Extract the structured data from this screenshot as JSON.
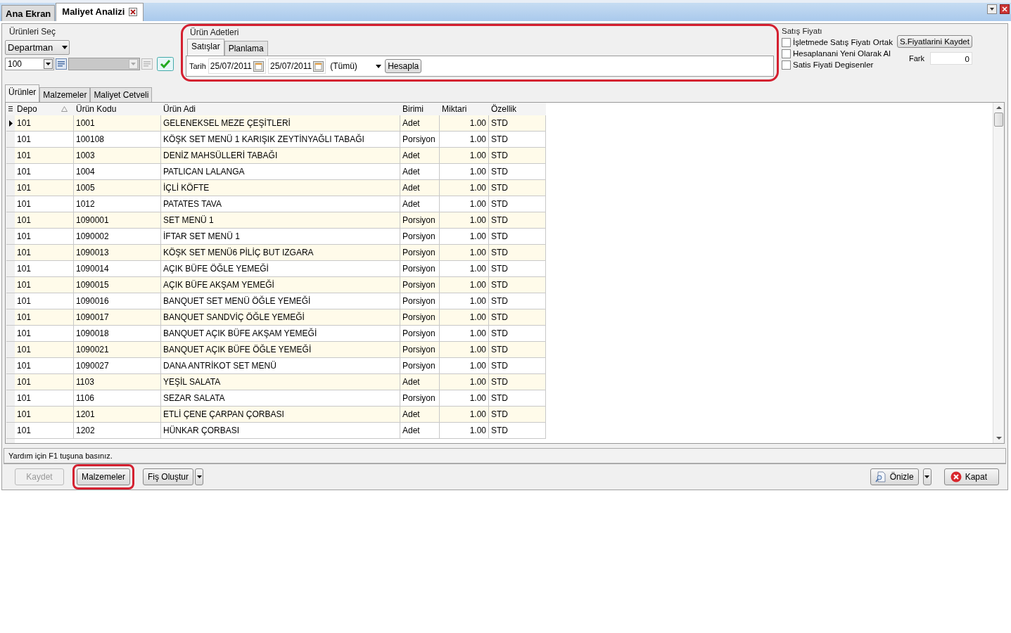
{
  "doc_tabs": [
    {
      "label": "Ana Ekran",
      "selected": false
    },
    {
      "label": "Maliyet Analizi",
      "selected": true,
      "closable": true
    }
  ],
  "select_group": {
    "legend": "Ürünleri Seç",
    "type_dropdown": "Departman",
    "code_value": "100"
  },
  "counts_group": {
    "legend": "Ürün Adetleri",
    "highlighted": true,
    "tabs": [
      {
        "label": "Satışlar",
        "selected": true
      },
      {
        "label": "Planlama",
        "selected": false
      }
    ],
    "date_label": "Tarih",
    "date_from": "25/07/2011",
    "date_to": "25/07/2011",
    "filter": "(Tümü)",
    "button": "Hesapla"
  },
  "price_group": {
    "legend": "Satış Fiyatı",
    "options": [
      {
        "label": "İşletmede Satış Fiyatı Ortak",
        "checked": false
      },
      {
        "label": "Hesaplanani Yeni Olarak Al",
        "checked": false
      },
      {
        "label": "Satis Fiyati Degisenler",
        "checked": false
      }
    ],
    "save_button": "S.Fiyatlarini Kaydet",
    "diff_label": "Fark",
    "diff_value": "0"
  },
  "view_tabs": [
    {
      "label": "Ürünler",
      "selected": true
    },
    {
      "label": "Malzemeler",
      "selected": false
    },
    {
      "label": "Maliyet Cetveli",
      "selected": false
    }
  ],
  "table": {
    "columns": [
      "Depo",
      "Ürün Kodu",
      "Ürün Adi",
      "Birimi",
      "Miktari",
      "Özellik"
    ],
    "rows": [
      {
        "selected": true,
        "cells": [
          "101",
          "1001",
          "GELENEKSEL MEZE ÇEŞİTLERİ",
          "Adet",
          "1.00",
          "STD"
        ]
      },
      {
        "selected": false,
        "cells": [
          "101",
          "100108",
          "KÖŞK SET MENÜ 1 KARIŞIK ZEYTİNYAĞLI TABAĞI",
          "Porsiyon",
          "1.00",
          "STD"
        ]
      },
      {
        "selected": false,
        "cells": [
          "101",
          "1003",
          "DENİZ MAHSÜLLERİ TABAĞI",
          "Adet",
          "1.00",
          "STD"
        ]
      },
      {
        "selected": false,
        "cells": [
          "101",
          "1004",
          "PATLICAN LALANGA",
          "Adet",
          "1.00",
          "STD"
        ]
      },
      {
        "selected": false,
        "cells": [
          "101",
          "1005",
          "İÇLİ KÖFTE",
          "Adet",
          "1.00",
          "STD"
        ]
      },
      {
        "selected": false,
        "cells": [
          "101",
          "1012",
          "PATATES TAVA",
          "Adet",
          "1.00",
          "STD"
        ]
      },
      {
        "selected": false,
        "cells": [
          "101",
          "1090001",
          "SET MENÜ 1",
          "Porsiyon",
          "1.00",
          "STD"
        ]
      },
      {
        "selected": false,
        "cells": [
          "101",
          "1090002",
          "İFTAR SET MENÜ 1",
          "Porsiyon",
          "1.00",
          "STD"
        ]
      },
      {
        "selected": false,
        "cells": [
          "101",
          "1090013",
          "KÖŞK SET MENÜ6 PİLİÇ BUT IZGARA",
          "Porsiyon",
          "1.00",
          "STD"
        ]
      },
      {
        "selected": false,
        "cells": [
          "101",
          "1090014",
          "AÇIK BÜFE ÖĞLE YEMEĞİ",
          "Porsiyon",
          "1.00",
          "STD"
        ]
      },
      {
        "selected": false,
        "cells": [
          "101",
          "1090015",
          "AÇIK BÜFE AKŞAM YEMEĞİ",
          "Porsiyon",
          "1.00",
          "STD"
        ]
      },
      {
        "selected": false,
        "cells": [
          "101",
          "1090016",
          "BANQUET SET MENÜ ÖĞLE YEMEĞİ",
          "Porsiyon",
          "1.00",
          "STD"
        ]
      },
      {
        "selected": false,
        "cells": [
          "101",
          "1090017",
          "BANQUET SANDVİÇ ÖĞLE YEMEĞİ",
          "Porsiyon",
          "1.00",
          "STD"
        ]
      },
      {
        "selected": false,
        "cells": [
          "101",
          "1090018",
          "BANQUET AÇIK BÜFE AKŞAM YEMEĞİ",
          "Porsiyon",
          "1.00",
          "STD"
        ]
      },
      {
        "selected": false,
        "cells": [
          "101",
          "1090021",
          "BANQUET AÇIK BÜFE ÖĞLE YEMEĞİ",
          "Porsiyon",
          "1.00",
          "STD"
        ]
      },
      {
        "selected": false,
        "cells": [
          "101",
          "1090027",
          "DANA ANTRİKOT SET MENÜ",
          "Porsiyon",
          "1.00",
          "STD"
        ]
      },
      {
        "selected": false,
        "cells": [
          "101",
          "1103",
          "YEŞİL SALATA",
          "Adet",
          "1.00",
          "STD"
        ]
      },
      {
        "selected": false,
        "cells": [
          "101",
          "1106",
          "SEZAR SALATA",
          "Porsiyon",
          "1.00",
          "STD"
        ]
      },
      {
        "selected": false,
        "cells": [
          "101",
          "1201",
          "ETLİ ÇENE ÇARPAN ÇORBASI",
          "Adet",
          "1.00",
          "STD"
        ]
      },
      {
        "selected": false,
        "cells": [
          "101",
          "1202",
          "HÜNKAR ÇORBASI",
          "Adet",
          "1.00",
          "STD"
        ]
      }
    ]
  },
  "status_bar": "Yardım için F1 tuşuna basınız.",
  "buttons": [
    {
      "label": "Kaydet",
      "kind": "plain",
      "disabled": true,
      "highlighted": false
    },
    {
      "label": "Malzemeler",
      "kind": "plain",
      "disabled": false,
      "highlighted": true
    },
    {
      "label": "Fiş Oluştur",
      "kind": "split",
      "disabled": false,
      "highlighted": false
    }
  ],
  "right_buttons": [
    {
      "label": "Önizle",
      "kind": "preview"
    },
    {
      "label": "Kapat",
      "kind": "close"
    }
  ]
}
